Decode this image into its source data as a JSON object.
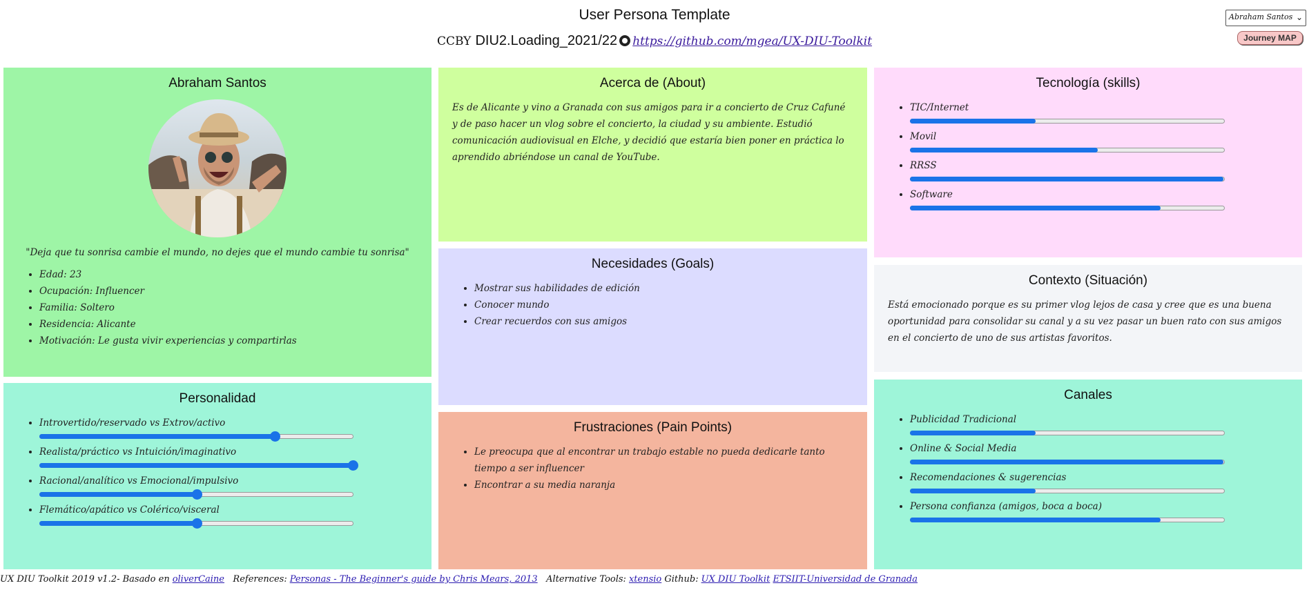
{
  "header": {
    "title": "User Persona Template",
    "license": "CCBY",
    "project": "DIU2.Loading_2021/22",
    "repo_link": "https://github.com/mgea/UX-DIU-Toolkit",
    "github_icon": "github-icon"
  },
  "controls": {
    "persona_select_value": "Abraham Santos",
    "journey_button": "Journey MAP"
  },
  "profile": {
    "name": "Abraham Santos",
    "quote": "\"Deja que tu sonrisa cambie el mundo, no dejes que el mundo cambie tu sonrisa\"",
    "details": [
      "Edad: 23",
      "Ocupación: Influencer",
      "Familia: Soltero",
      "Residencia: Alicante",
      "Motivación: Le gusta vivir experiencias y compartirlas"
    ]
  },
  "personality": {
    "title": "Personalidad",
    "traits": [
      {
        "label": "Introvertido/reservado vs Extrov/activo",
        "level": 0.75
      },
      {
        "label": "Realista/práctico vs Intuición/imaginativo",
        "level": 1.0
      },
      {
        "label": "Racional/analítico vs Emocional/impulsivo",
        "level": 0.5
      },
      {
        "label": "Flemático/apático vs Colérico/visceral",
        "level": 0.5
      }
    ]
  },
  "about": {
    "title": "Acerca de (About)",
    "text": "Es de Alicante y vino a Granada con sus amigos para ir a concierto de Cruz Cafuné y de paso hacer un vlog sobre el concierto, la ciudad y su ambiente. Estudió comunicación audiovisual en Elche, y decidió que estaría bien poner en práctica lo aprendido abriéndose un canal de YouTube."
  },
  "goals": {
    "title": "Necesidades (Goals)",
    "items": [
      "Mostrar sus habilidades de edición",
      "Conocer mundo",
      "Crear recuerdos con sus amigos"
    ]
  },
  "frustrations": {
    "title": "Frustraciones (Pain Points)",
    "items": [
      "Le preocupa que al encontrar un trabajo estable no pueda dedicarle tanto tiempo a ser influencer",
      "Encontrar a su media naranja"
    ]
  },
  "tech": {
    "title": "Tecnología (skills)",
    "skills": [
      {
        "label": "TIC/Internet",
        "level": 0.4
      },
      {
        "label": "Movil",
        "level": 0.6
      },
      {
        "label": "RRSS",
        "level": 1.0
      },
      {
        "label": "Software",
        "level": 0.8
      }
    ]
  },
  "context": {
    "title": "Contexto (Situación)",
    "text": "Está emocionado porque es su primer vlog lejos de casa y cree que es una buena oportunidad para consolidar su canal y a su vez pasar un buen rato con sus amigos en el concierto de uno de sus artistas favoritos."
  },
  "channels": {
    "title": "Canales",
    "items": [
      {
        "label": "Publicidad Tradicional",
        "level": 0.4
      },
      {
        "label": "Online & Social Media",
        "level": 1.0
      },
      {
        "label": "Recomendaciones & sugerencias",
        "level": 0.4
      },
      {
        "label": "Persona confianza (amigos, boca a boca)",
        "level": 0.8
      }
    ]
  },
  "footer": {
    "prefix": "UX DIU Toolkit 2019 v1.2- Basado en",
    "based_link": "oliverCaine",
    "references_label": "References:",
    "references_link": "Personas - The Beginner's guide by Chris Mears, 2013",
    "alt_label": "Alternative Tools:",
    "alt_link": "xtensio",
    "github_label": "Github:",
    "github_link": "UX DIU Toolkit",
    "univ_link": "ETSIIT-Universidad de Granada"
  },
  "colors": {
    "slider_blue": "#1a73e8",
    "profile_bg": "#9ef5a6",
    "personality_bg": "#9ef5d9",
    "about_bg": "#cfff9e",
    "goals_bg": "#dcdcff",
    "frustrations_bg": "#f4b59e",
    "tech_bg": "#ffdbfb",
    "context_bg": "#f3f5f8",
    "channels_bg": "#9ef5d9"
  }
}
